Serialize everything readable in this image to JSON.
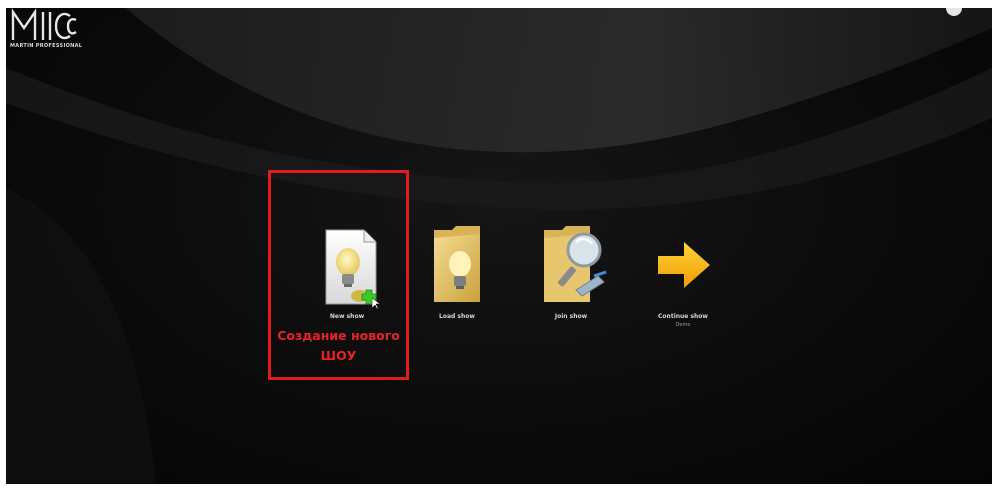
{
  "app": {
    "logo_text": "M",
    "logo_subtitle": "MARTIN PROFESSIONAL"
  },
  "actions": [
    {
      "id": "new-show",
      "label": "New show",
      "sublabel": ""
    },
    {
      "id": "load-show",
      "label": "Load show",
      "sublabel": ""
    },
    {
      "id": "join-show",
      "label": "Join show",
      "sublabel": ""
    },
    {
      "id": "continue-show",
      "label": "Continue show",
      "sublabel": "Demo"
    }
  ],
  "annotation": {
    "line1": "Создание нового",
    "line2": "ШОУ",
    "color": "#e8222a"
  },
  "colors": {
    "background": "#0b0b0b",
    "accent_arrow": "#f7b500",
    "folder": "#e9c86a",
    "highlight": "#e01d1d"
  },
  "icons": {
    "new_show": "document-lightbulb-icon",
    "load_show": "folder-lightbulb-icon",
    "join_show": "folder-search-icon",
    "continue_show": "arrow-right-icon"
  }
}
